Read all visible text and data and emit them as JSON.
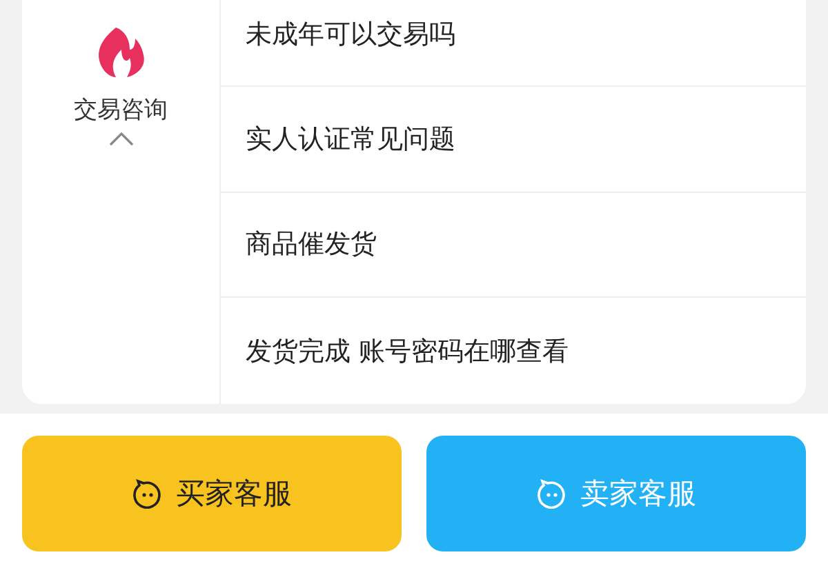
{
  "category": {
    "label": "交易咨询",
    "expanded": true
  },
  "questions": [
    "未成年可以交易吗",
    "实人认证常见问题",
    "商品催发货",
    "发货完成 账号密码在哪查看"
  ],
  "buttons": [
    {
      "label": "买家客服",
      "kind": "buyer"
    },
    {
      "label": "卖家客服",
      "kind": "seller"
    }
  ]
}
